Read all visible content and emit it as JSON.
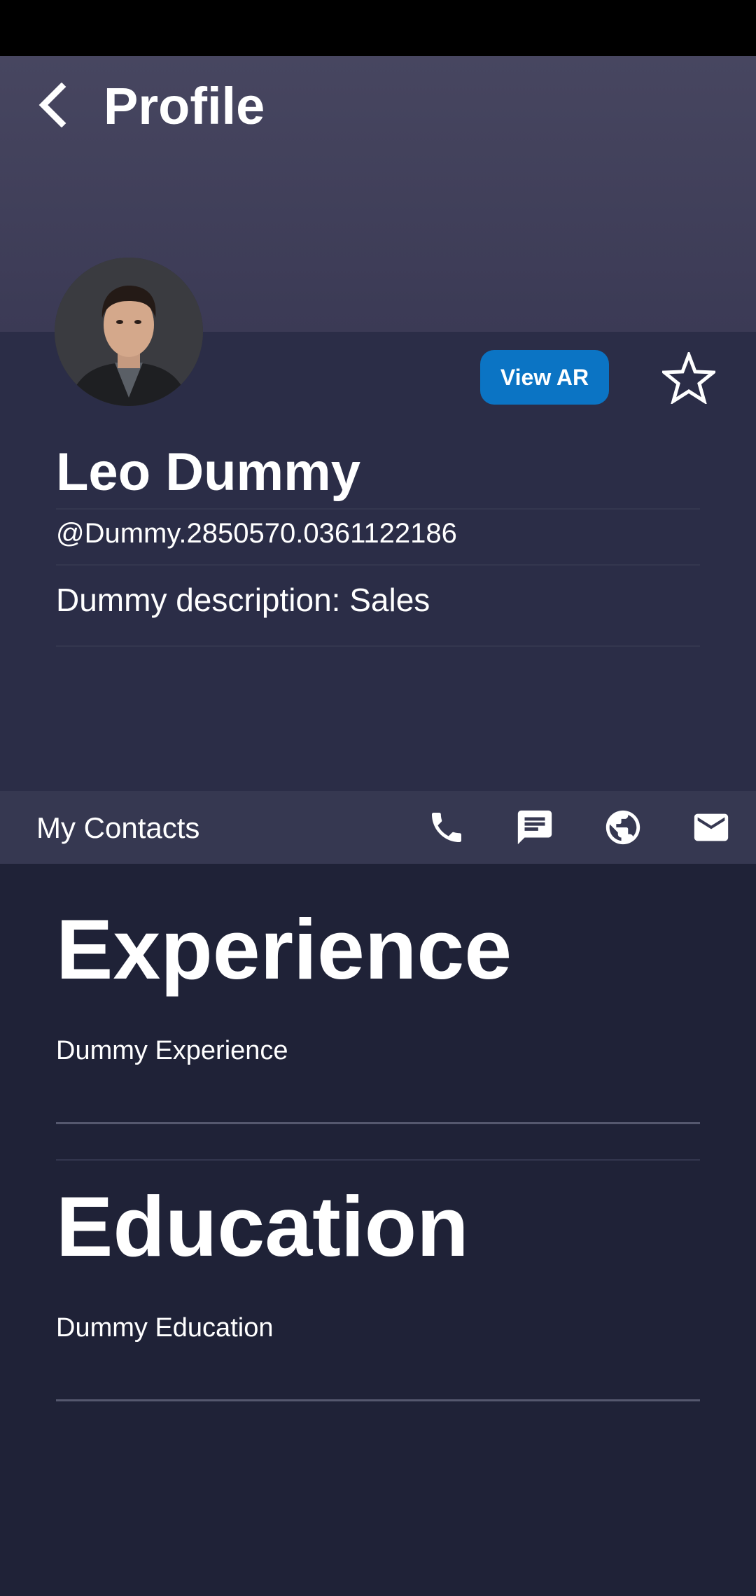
{
  "header": {
    "title": "Profile"
  },
  "profile": {
    "name": "Leo Dummy",
    "username": "@Dummy.2850570.0361122186",
    "description": "Dummy description: Sales",
    "view_ar_label": "View AR"
  },
  "contacts": {
    "label": "My Contacts",
    "icons": [
      "phone-icon",
      "message-icon",
      "globe-icon",
      "email-icon"
    ]
  },
  "sections": [
    {
      "title": "Experience",
      "text": "Dummy Experience"
    },
    {
      "title": "Education",
      "text": "Dummy Education"
    }
  ],
  "colors": {
    "accent": "#0b74c4",
    "background": "#1f2237",
    "profile_panel": "#2b2d47",
    "contacts_bar": "#363851"
  }
}
